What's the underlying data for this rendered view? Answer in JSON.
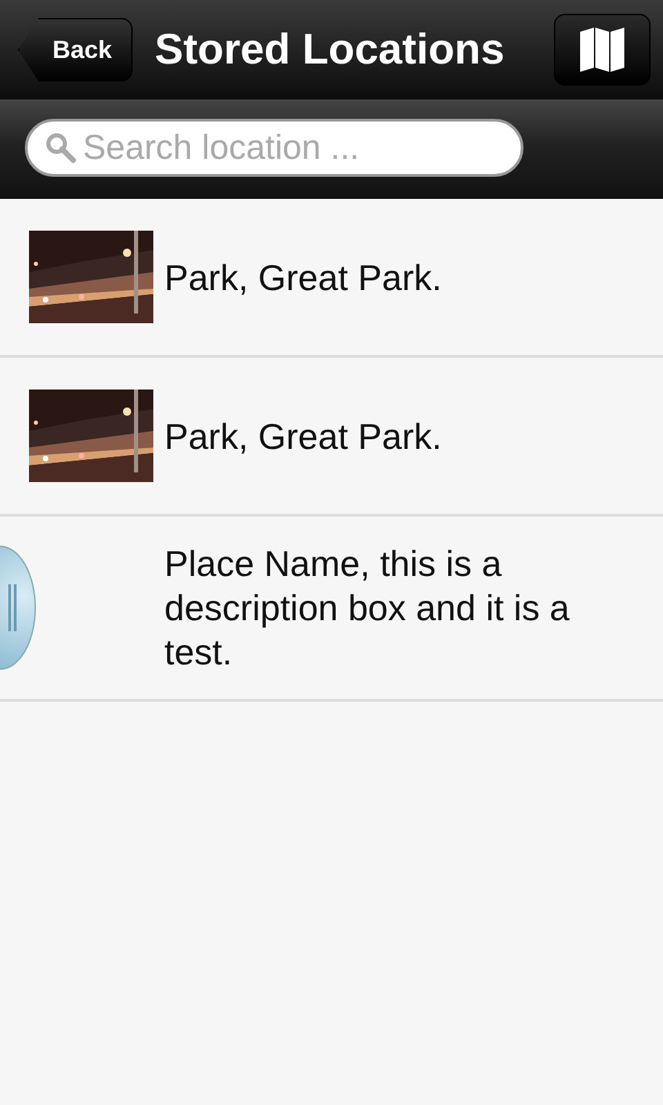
{
  "header": {
    "back": "Back",
    "title": "Stored Locations"
  },
  "search": {
    "placeholder": "Search location ..."
  },
  "locations": [
    {
      "text": "Park, Great Park."
    },
    {
      "text": "Park, Great Park."
    },
    {
      "text": "Place Name, this is a description box and it is a test."
    }
  ]
}
